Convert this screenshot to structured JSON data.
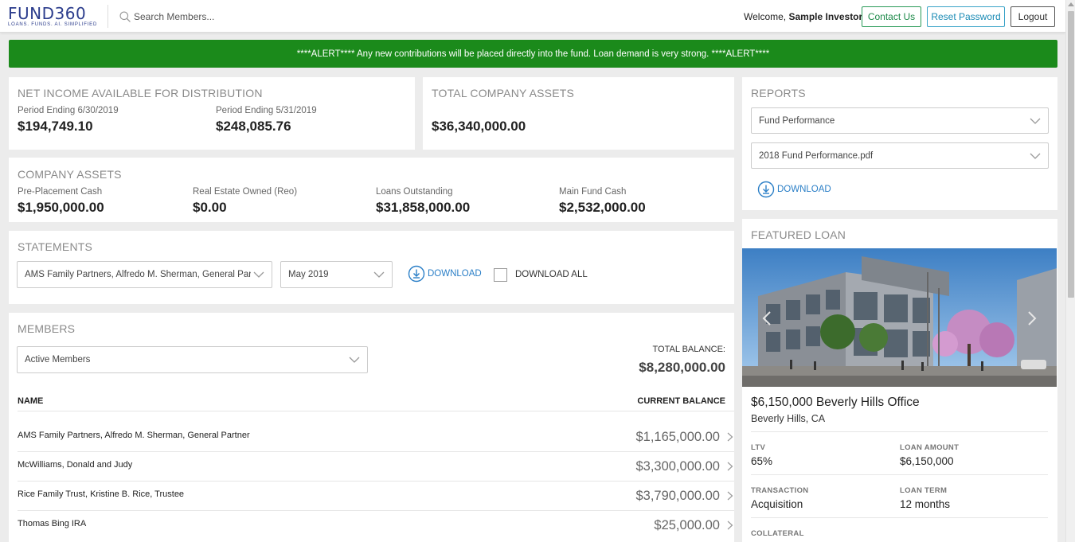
{
  "header": {
    "logo_text": "FUND360",
    "logo_tagline": "LOANS. FUNDS. AI. SIMPLIFIED",
    "search_placeholder": "Search Members...",
    "welcome_prefix": "Welcome,",
    "user_name": "Sample Investor",
    "contact_label": "Contact Us",
    "reset_label": "Reset Password",
    "logout_label": "Logout"
  },
  "alert": {
    "text": "****ALERT**** Any new contributions will be placed directly into the fund. Loan demand is very strong. ****ALERT****"
  },
  "net_income": {
    "title": "NET INCOME AVAILABLE FOR DISTRIBUTION",
    "periods": [
      {
        "label": "Period Ending 6/30/2019",
        "value": "$194,749.10"
      },
      {
        "label": "Period Ending 5/31/2019",
        "value": "$248,085.76"
      }
    ]
  },
  "total_assets": {
    "title": "TOTAL COMPANY ASSETS",
    "value": "$36,340,000.00"
  },
  "company_assets": {
    "title": "COMPANY ASSETS",
    "items": [
      {
        "label": "Pre-Placement Cash",
        "value": "$1,950,000.00"
      },
      {
        "label": "Real Estate Owned (Reo)",
        "value": "$0.00"
      },
      {
        "label": "Loans Outstanding",
        "value": "$31,858,000.00"
      },
      {
        "label": "Main Fund Cash",
        "value": "$2,532,000.00"
      }
    ]
  },
  "statements": {
    "title": "STATEMENTS",
    "member_select": "AMS Family Partners, Alfredo M. Sherman, General Partner",
    "month_select": "May 2019",
    "download_label": "DOWNLOAD",
    "download_all_label": "DOWNLOAD ALL"
  },
  "members": {
    "title": "MEMBERS",
    "filter_select": "Active Members",
    "total_label": "TOTAL BALANCE:",
    "total_value": "$8,280,000.00",
    "col_name": "NAME",
    "col_balance": "CURRENT BALANCE",
    "rows": [
      {
        "name": "AMS Family Partners, Alfredo M. Sherman, General Partner",
        "balance": "$1,165,000.00"
      },
      {
        "name": "McWilliams, Donald and Judy",
        "balance": "$3,300,000.00"
      },
      {
        "name": "Rice Family Trust, Kristine B. Rice, Trustee",
        "balance": "$3,790,000.00"
      },
      {
        "name": "Thomas Bing IRA",
        "balance": "$25,000.00"
      }
    ]
  },
  "reports": {
    "title": "REPORTS",
    "report_select": "Fund Performance",
    "file_select": "2018 Fund Performance.pdf",
    "download_label": "DOWNLOAD"
  },
  "featured_loan": {
    "title": "FEATURED LOAN",
    "loan_title": "$6,150,000 Beverly Hills Office",
    "location": "Beverly Hills, CA",
    "fields": [
      {
        "label": "LTV",
        "value": "65%"
      },
      {
        "label": "LOAN AMOUNT",
        "value": "$6,150,000"
      },
      {
        "label": "TRANSACTION",
        "value": "Acquisition"
      },
      {
        "label": "LOAN TERM",
        "value": "12 months"
      },
      {
        "label": "COLLATERAL",
        "value": ""
      }
    ]
  },
  "colors": {
    "alert_green": "#1b8a1b",
    "brand_blue": "#2b3c8c",
    "link_blue": "#2b7fc7",
    "contact_green": "#1e8a4a",
    "reset_blue": "#1a8bb5"
  }
}
